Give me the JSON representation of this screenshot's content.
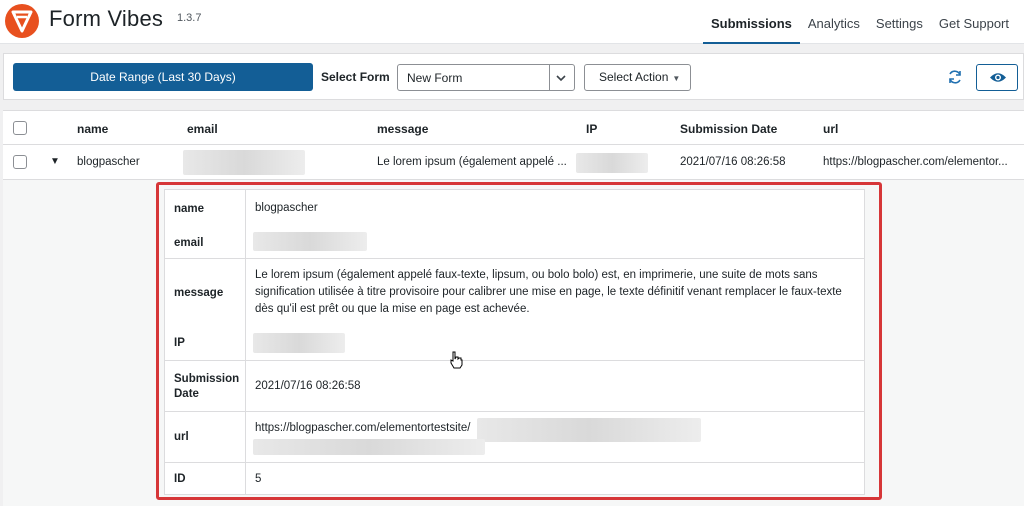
{
  "app": {
    "title": "Form Vibes",
    "version": "1.3.7",
    "brand_color": "#e8501f"
  },
  "nav": [
    {
      "label": "Submissions",
      "active": true
    },
    {
      "label": "Analytics",
      "active": false
    },
    {
      "label": "Settings",
      "active": false
    },
    {
      "label": "Get Support",
      "active": false
    }
  ],
  "toolbar": {
    "date_range_label": "Date Range (Last 30 Days)",
    "select_form_label": "Select Form",
    "selected_form": "New Form",
    "select_action_label": "Select Action",
    "refresh_icon": "refresh-icon",
    "view_icon": "eye-icon",
    "accent_color": "#135e96"
  },
  "table": {
    "columns": [
      "name",
      "email",
      "message",
      "IP",
      "Submission Date",
      "url"
    ],
    "row": {
      "name": "blogpascher",
      "message": "Le lorem ipsum (également appelé ...",
      "submission_date": "2021/07/16 08:26:58",
      "url": "https://blogpascher.com/elementor..."
    }
  },
  "detail": {
    "labels": {
      "name": "name",
      "email": "email",
      "message": "message",
      "ip": "IP",
      "submission_date": "Submission Date",
      "url": "url",
      "id": "ID"
    },
    "name": "blogpascher",
    "message": "Le lorem ipsum (également appelé faux-texte, lipsum, ou bolo bolo) est, en imprimerie, une suite de mots sans signification utilisée à titre provisoire pour calibrer une mise en page, le texte définitif venant remplacer le faux-texte dès qu'il est prêt ou que la mise en page est achevée.",
    "submission_date": "2021/07/16 08:26:58",
    "url": "https://blogpascher.com/elementortestsite/",
    "id": "5",
    "highlight_color": "#d63638"
  }
}
